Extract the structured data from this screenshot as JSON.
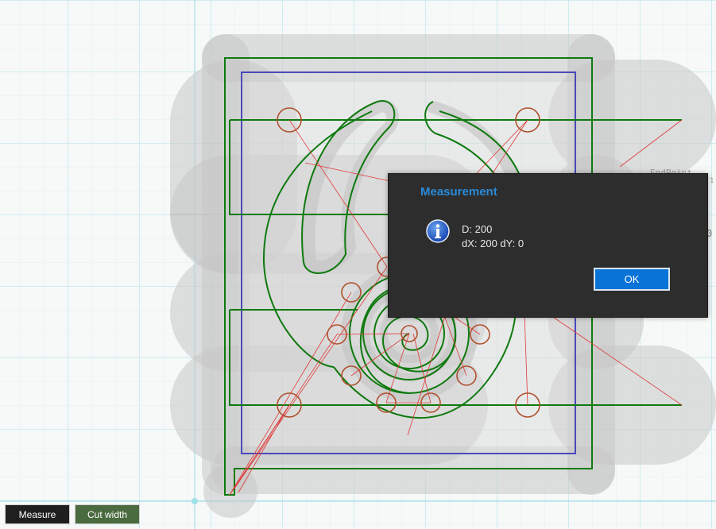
{
  "canvas": {
    "background_labels": [
      "EndPoint",
      "1",
      "0"
    ]
  },
  "dialog": {
    "title": "Measurement",
    "icon": "info-icon",
    "line1": "D: 200",
    "line2": "dX: 200 dY: 0",
    "ok_label": "OK"
  },
  "toolbar": {
    "measure_label": "Measure",
    "cut_width_label": "Cut width"
  },
  "colors": {
    "grid": "#cdeef0",
    "cut_path": "#0e7a0e",
    "stock": "#3a3ab8",
    "holes": "#b0502e",
    "rapid_moves": "#e03a3a",
    "dialog_bg": "#2d2d2d",
    "dialog_title": "#2a8ad8",
    "ok_button": "#0a73d8"
  }
}
